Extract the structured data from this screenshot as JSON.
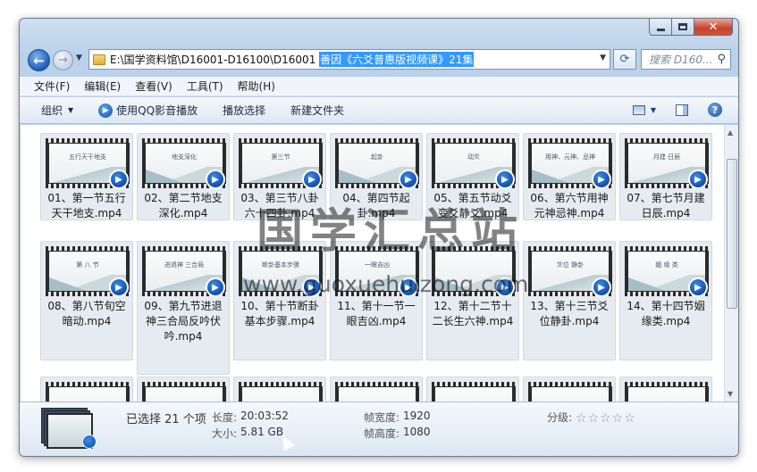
{
  "window": {
    "caption": {
      "minimize_icon": "minimize-icon",
      "maximize_icon": "maximize-icon",
      "close_icon": "close-icon"
    }
  },
  "address_bar": {
    "path": "E:\\国学资料馆\\D16001-D16100\\D16001",
    "selected": "善因《六爻普惠版视频课》21集",
    "search_placeholder": "搜索 D160..."
  },
  "menu": [
    "文件(F)",
    "编辑(E)",
    "查看(V)",
    "工具(T)",
    "帮助(H)"
  ],
  "toolbar": {
    "organize": "组织",
    "qq_play": "使用QQ影音播放",
    "playlist": "播放选择",
    "new_folder": "新建文件夹"
  },
  "files": [
    {
      "label": "01、第一节五行天干地支.mp4",
      "thumb": "五行天干地支"
    },
    {
      "label": "02、第二节地支深化.mp4",
      "thumb": "地支深化"
    },
    {
      "label": "03、第三节八卦六十四卦.mp4",
      "thumb": "第三节"
    },
    {
      "label": "04、第四节起卦.mp4",
      "thumb": "起卦"
    },
    {
      "label": "05、第五节动爻变爻静爻.mp4",
      "thumb": "动爻"
    },
    {
      "label": "06、第六节用神元神忌神.mp4",
      "thumb": "用神、元神、忌神"
    },
    {
      "label": "07、第七节月建日辰.mp4",
      "thumb": "月建 日辰"
    },
    {
      "label": "08、第八节旬空暗动.mp4",
      "thumb": "第 八 节"
    },
    {
      "label": "09、第九节进退神三合局反吟伏吟.mp4",
      "thumb": "进退神 三合局"
    },
    {
      "label": "10、第十节断卦基本步骤.mp4",
      "thumb": "断卦基本步骤"
    },
    {
      "label": "11、第十一节一眼吉凶.mp4",
      "thumb": "一眼吉凶"
    },
    {
      "label": "12、第十二节十二长生六神.mp4",
      "thumb": ""
    },
    {
      "label": "13、第十三节爻位静卦.mp4",
      "thumb": "爻位 静卦"
    },
    {
      "label": "14、第十四节姻缘类.mp4",
      "thumb": "姻 缘 类"
    },
    {
      "label": "",
      "thumb": ""
    },
    {
      "label": "",
      "thumb": ""
    },
    {
      "label": "",
      "thumb": ""
    },
    {
      "label": "",
      "thumb": ""
    },
    {
      "label": "",
      "thumb": ""
    },
    {
      "label": "",
      "thumb": ""
    },
    {
      "label": "",
      "thumb": ""
    }
  ],
  "watermark": {
    "name": "国学汇总站",
    "url": "www.guoxuehuizong.com"
  },
  "details": {
    "selected": "已选择 21 个项",
    "length_key": "长度:",
    "length_val": "20:03:52",
    "size_key": "大小:",
    "size_val": "5.81 GB",
    "frame_width_key": "帧宽度:",
    "frame_width_val": "1920",
    "frame_height_key": "帧高度:",
    "frame_height_val": "1080",
    "rating_key": "分级:",
    "rating_stars": "☆☆☆☆☆"
  }
}
